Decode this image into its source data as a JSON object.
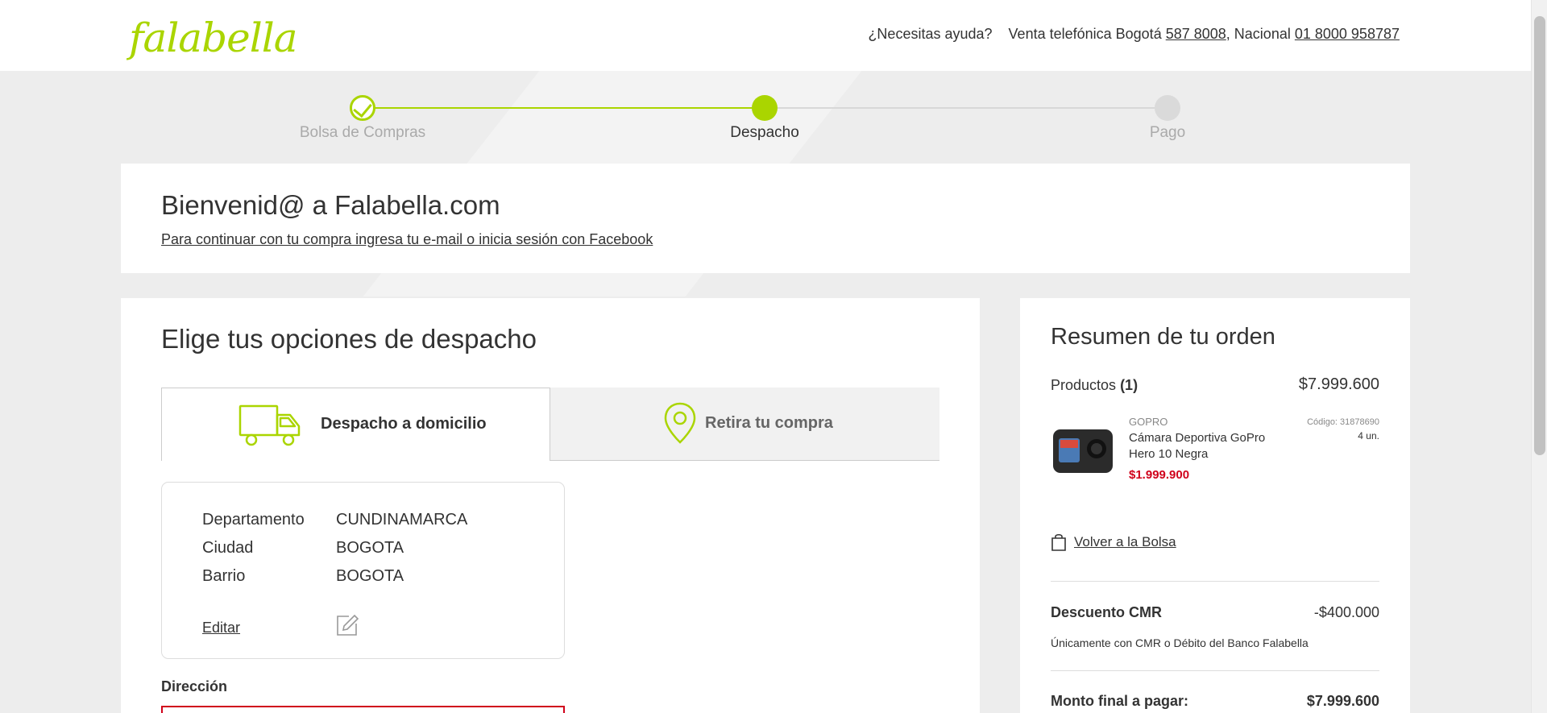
{
  "header": {
    "logo": "falabella",
    "help_text": "¿Necesitas ayuda?",
    "phone_prefix": "Venta telefónica Bogotá",
    "phone_bogota": "587 8008",
    "national_prefix": ", Nacional",
    "phone_national": "01 8000 958787"
  },
  "stepper": {
    "steps": [
      {
        "label": "Bolsa de Compras",
        "state": "done"
      },
      {
        "label": "Despacho",
        "state": "active"
      },
      {
        "label": "Pago",
        "state": "pending"
      }
    ],
    "accent": "#aad500"
  },
  "welcome": {
    "title": "Bienvenid@ a Falabella.com",
    "link": "Para continuar con tu compra ingresa tu e-mail o inicia sesión con Facebook"
  },
  "delivery": {
    "title": "Elige tus opciones de despacho",
    "tabs": [
      {
        "label": "Despacho a domicilio",
        "icon": "truck-icon",
        "selected": true
      },
      {
        "label": "Retira tu compra",
        "icon": "location-pin-icon",
        "selected": false
      }
    ],
    "location": {
      "rows": [
        {
          "key": "Departamento",
          "value": "CUNDINAMARCA"
        },
        {
          "key": "Ciudad",
          "value": "BOGOTA"
        },
        {
          "key": "Barrio",
          "value": "BOGOTA"
        }
      ],
      "edit_label": "Editar"
    },
    "address_label": "Dirección",
    "error_color": "#d0021b"
  },
  "summary": {
    "title": "Resumen de tu orden",
    "products_label": "Productos",
    "products_count": "(1)",
    "products_total": "$7.999.600",
    "item": {
      "brand": "GOPRO",
      "name": "Cámara Deportiva GoPro Hero 10 Negra",
      "price": "$1.999.900",
      "code": "Código: 31878690",
      "qty": "4 un."
    },
    "back_link": "Volver a la Bolsa",
    "discount_label": "Descuento CMR",
    "discount_value": "-$400.000",
    "discount_note": "Únicamente con CMR o Débito del Banco Falabella",
    "final_label": "Monto final a pagar:",
    "final_value": "$7.999.600"
  }
}
